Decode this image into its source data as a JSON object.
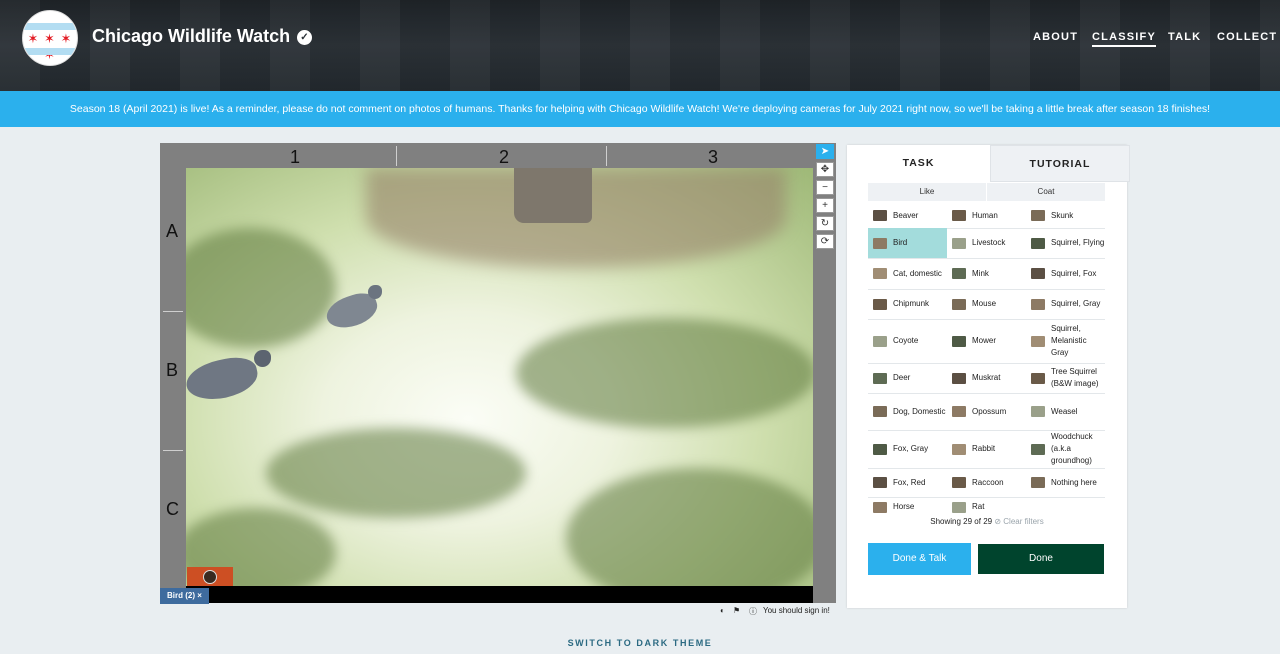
{
  "header": {
    "title": "Chicago Wildlife Watch",
    "verified_icon": "check-circle-icon",
    "nav": [
      "ABOUT",
      "CLASSIFY",
      "TALK",
      "COLLECT"
    ],
    "active_nav": "CLASSIFY"
  },
  "announcement": "Season 18 (April 2021) is live! As a reminder, please do not comment on photos of humans. Thanks for helping with Chicago Wildlife Watch! We're deploying cameras for July 2021 right now, so we'll be taking a little break after season 18 finishes!",
  "viewer": {
    "columns": [
      "1",
      "2",
      "3"
    ],
    "rows": [
      "A",
      "B",
      "C"
    ],
    "mark_tag": "Bird (2)",
    "mark_remove": "×",
    "tools": [
      "pointer-icon",
      "move-icon",
      "zoom-out-icon",
      "zoom-in-icon",
      "rotate-icon",
      "reset-icon"
    ],
    "sign_in_notice": "You should sign in!"
  },
  "task": {
    "tabs": [
      "TASK",
      "TUTORIAL"
    ],
    "filters": [
      "Like",
      "Coat"
    ],
    "choices": [
      [
        "Beaver",
        "Human",
        "Skunk"
      ],
      [
        "Bird",
        "Livestock",
        "Squirrel, Flying"
      ],
      [
        "Cat, domestic",
        "Mink",
        "Squirrel, Fox"
      ],
      [
        "Chipmunk",
        "Mouse",
        "Squirrel, Gray"
      ],
      [
        "Coyote",
        "Mower",
        "Squirrel, Melanistic Gray"
      ],
      [
        "Deer",
        "Muskrat",
        "Tree Squirrel (B&W image)"
      ],
      [
        "Dog, Domestic",
        "Opossum",
        "Weasel"
      ],
      [
        "Fox, Gray",
        "Rabbit",
        "Woodchuck (a.k.a groundhog)"
      ],
      [
        "Fox, Red",
        "Raccoon",
        "Nothing here"
      ],
      [
        "Horse",
        "Rat",
        ""
      ]
    ],
    "selected": "Bird",
    "showing": "Showing 29 of 29",
    "clear_filters": "Clear filters",
    "done_talk": "Done & Talk",
    "done": "Done"
  },
  "footer": {
    "dark_theme": "SWITCH TO DARK THEME"
  },
  "colors": {
    "accent": "#2bb0ed",
    "done": "#00442d",
    "selected": "#a3dcdc"
  }
}
